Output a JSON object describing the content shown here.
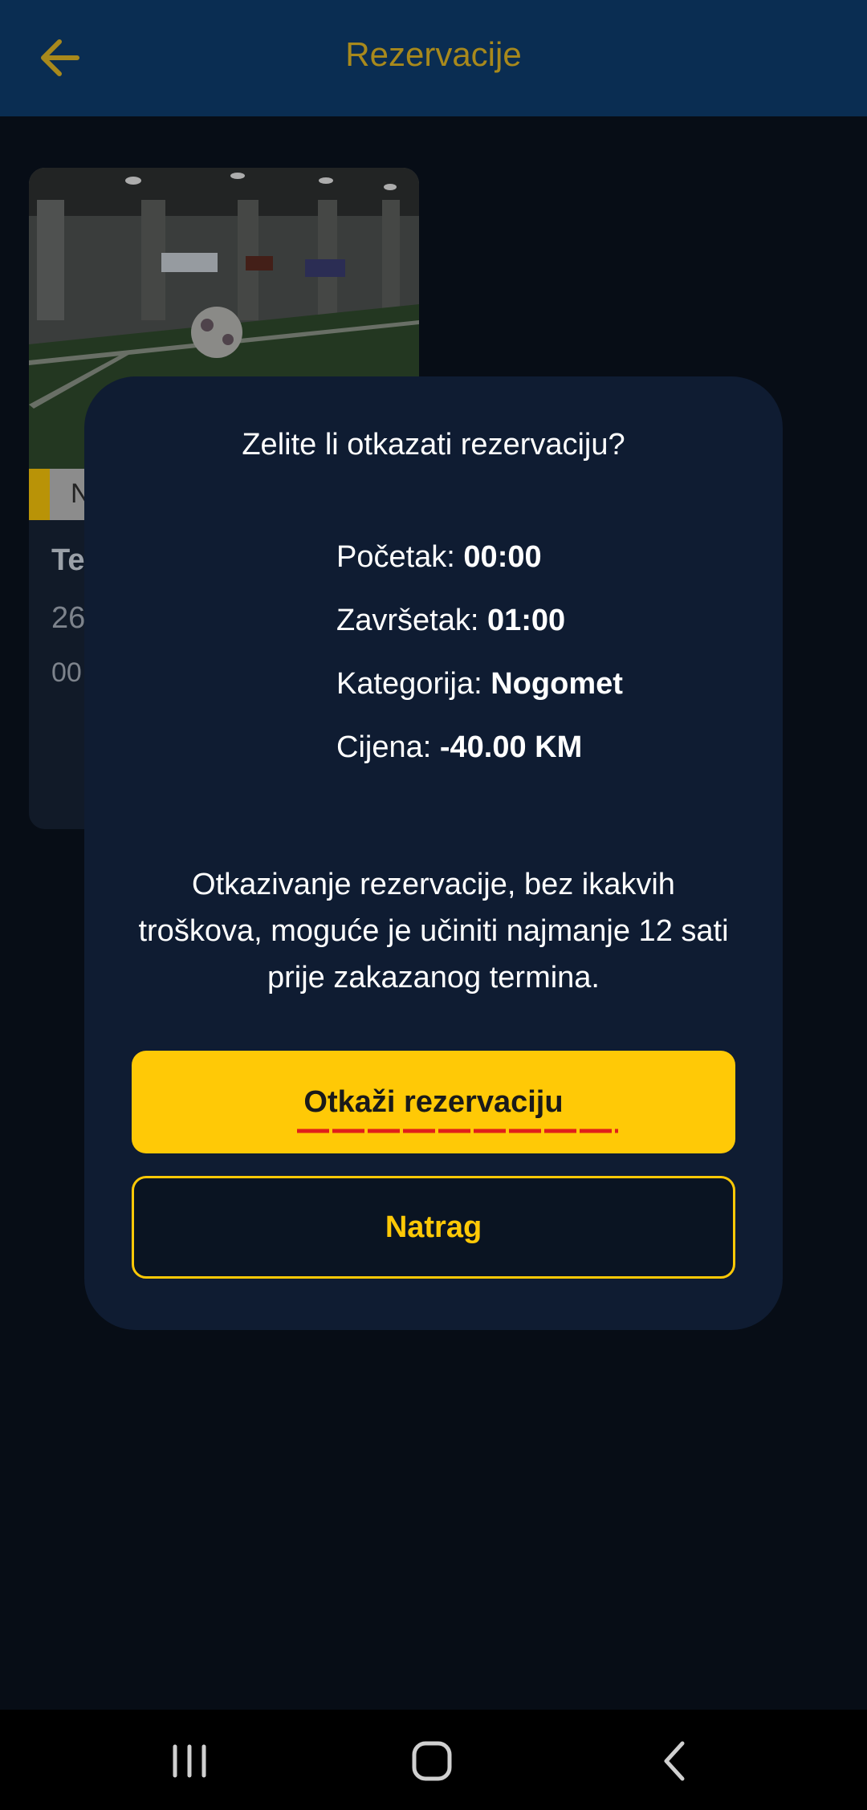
{
  "appbar": {
    "title": "Rezervacije",
    "back_icon": "arrow-left-icon"
  },
  "card": {
    "tag_label": "N",
    "name_partial": "Te",
    "date_partial": "26",
    "time_partial": "00"
  },
  "dialog": {
    "title": "Zelite li otkazati rezervaciju?",
    "details": [
      {
        "label": "Početak: ",
        "value": "00:00"
      },
      {
        "label": "Završetak: ",
        "value": "01:00"
      },
      {
        "label": "Kategorija: ",
        "value": "Nogomet"
      },
      {
        "label": "Cijena: ",
        "value": "-40.00 KM"
      }
    ],
    "notice": "Otkazivanje rezervacije, bez ikakvih troškova, moguće je učiniti najmanje 12 sati prije zakazanog termina.",
    "confirm_label": "Otkaži rezervaciju",
    "back_label": "Natrag"
  },
  "colors": {
    "appbar_bg": "#0a2d52",
    "accent": "#ffc906",
    "dialog_bg": "#0f1c32",
    "screen_bg": "#070d16"
  },
  "system_nav": {
    "recents_icon": "recents-icon",
    "home_icon": "home-icon",
    "back_icon": "system-back-icon"
  }
}
